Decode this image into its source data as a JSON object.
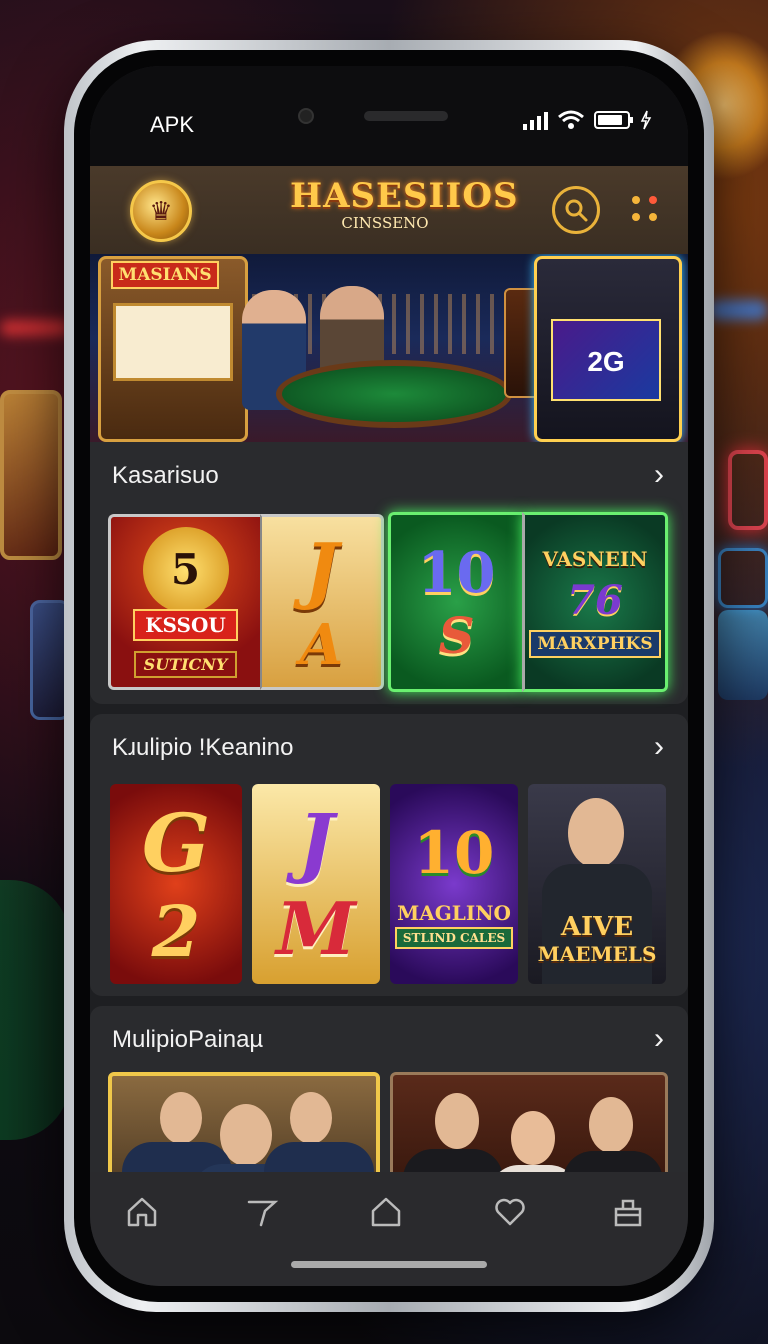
{
  "status_bar": {
    "left_label": "APK"
  },
  "header": {
    "brand_main": "HASESIIOS",
    "brand_sub": "CINSSENO"
  },
  "banner": {
    "left_sign": "MASIANS",
    "right_screen": "2G"
  },
  "sections": [
    {
      "title": "Kasarisuo",
      "tiles": [
        {
          "line1": "5",
          "line2": "KSSOU",
          "line3": "SUTICNY"
        },
        {
          "line1": "J",
          "line2": "A"
        },
        {
          "line1": "10",
          "line2": "S"
        },
        {
          "line1": "VASNEIN",
          "line2": "76",
          "line3": "MARXPHKS"
        }
      ]
    },
    {
      "title": "Kɹulipio !Keanino",
      "tiles": [
        {
          "line1": "G",
          "line2": "2"
        },
        {
          "line1": "J",
          "line2": "M"
        },
        {
          "line1": "10",
          "line2": "MAGLINO",
          "line3": "STLIND CALES"
        },
        {
          "line1": "AIVE",
          "line2": "MAEMELS"
        }
      ]
    },
    {
      "title": "MulipioPainaµ",
      "tiles": [
        {},
        {}
      ]
    }
  ],
  "colors": {
    "accent_gold": "#f0c84a",
    "highlight_green": "#6af070",
    "card_bg": "#2a2b2e"
  },
  "icons": [
    "home-icon",
    "tag-icon",
    "house-icon",
    "heart-icon",
    "bag-icon",
    "search-icon",
    "menu-dots-icon",
    "chevron-right-icon"
  ]
}
